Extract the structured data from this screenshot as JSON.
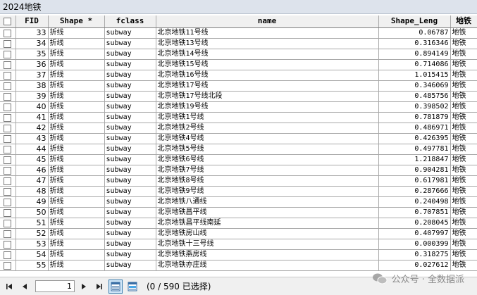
{
  "window": {
    "title": "2024地铁"
  },
  "table": {
    "columns": {
      "fid": "FID",
      "shape": "Shape *",
      "fclass": "fclass",
      "name": "name",
      "shape_leng": "Shape_Leng",
      "type": "地铁"
    },
    "rows": [
      {
        "fid": "33",
        "shape": "折线",
        "fclass": "subway",
        "name": "北京地铁11号线",
        "len": "0.06787",
        "type": "地铁"
      },
      {
        "fid": "34",
        "shape": "折线",
        "fclass": "subway",
        "name": "北京地铁13号线",
        "len": "0.316346",
        "type": "地铁"
      },
      {
        "fid": "35",
        "shape": "折线",
        "fclass": "subway",
        "name": "北京地铁14号线",
        "len": "0.894149",
        "type": "地铁"
      },
      {
        "fid": "36",
        "shape": "折线",
        "fclass": "subway",
        "name": "北京地铁15号线",
        "len": "0.714086",
        "type": "地铁"
      },
      {
        "fid": "37",
        "shape": "折线",
        "fclass": "subway",
        "name": "北京地铁16号线",
        "len": "1.015415",
        "type": "地铁"
      },
      {
        "fid": "38",
        "shape": "折线",
        "fclass": "subway",
        "name": "北京地铁17号线",
        "len": "0.346069",
        "type": "地铁"
      },
      {
        "fid": "39",
        "shape": "折线",
        "fclass": "subway",
        "name": "北京地铁17号线北段",
        "len": "0.485756",
        "type": "地铁"
      },
      {
        "fid": "40",
        "shape": "折线",
        "fclass": "subway",
        "name": "北京地铁19号线",
        "len": "0.398502",
        "type": "地铁"
      },
      {
        "fid": "41",
        "shape": "折线",
        "fclass": "subway",
        "name": "北京地铁1号线",
        "len": "0.781879",
        "type": "地铁"
      },
      {
        "fid": "42",
        "shape": "折线",
        "fclass": "subway",
        "name": "北京地铁2号线",
        "len": "0.486971",
        "type": "地铁"
      },
      {
        "fid": "43",
        "shape": "折线",
        "fclass": "subway",
        "name": "北京地铁4号线",
        "len": "0.426395",
        "type": "地铁"
      },
      {
        "fid": "44",
        "shape": "折线",
        "fclass": "subway",
        "name": "北京地铁5号线",
        "len": "0.497781",
        "type": "地铁"
      },
      {
        "fid": "45",
        "shape": "折线",
        "fclass": "subway",
        "name": "北京地铁6号线",
        "len": "1.218847",
        "type": "地铁"
      },
      {
        "fid": "46",
        "shape": "折线",
        "fclass": "subway",
        "name": "北京地铁7号线",
        "len": "0.904281",
        "type": "地铁"
      },
      {
        "fid": "47",
        "shape": "折线",
        "fclass": "subway",
        "name": "北京地铁8号线",
        "len": "0.617981",
        "type": "地铁"
      },
      {
        "fid": "48",
        "shape": "折线",
        "fclass": "subway",
        "name": "北京地铁9号线",
        "len": "0.287666",
        "type": "地铁"
      },
      {
        "fid": "49",
        "shape": "折线",
        "fclass": "subway",
        "name": "北京地铁八通线",
        "len": "0.240498",
        "type": "地铁"
      },
      {
        "fid": "50",
        "shape": "折线",
        "fclass": "subway",
        "name": "北京地铁昌平线",
        "len": "0.707851",
        "type": "地铁"
      },
      {
        "fid": "51",
        "shape": "折线",
        "fclass": "subway",
        "name": "北京地铁昌平线南延",
        "len": "0.208045",
        "type": "地铁"
      },
      {
        "fid": "52",
        "shape": "折线",
        "fclass": "subway",
        "name": "北京地铁房山线",
        "len": "0.407997",
        "type": "地铁"
      },
      {
        "fid": "53",
        "shape": "折线",
        "fclass": "subway",
        "name": "北京地铁十三号线",
        "len": "0.000399",
        "type": "地铁"
      },
      {
        "fid": "54",
        "shape": "折线",
        "fclass": "subway",
        "name": "北京地铁燕房线",
        "len": "0.318275",
        "type": "地铁"
      },
      {
        "fid": "55",
        "shape": "折线",
        "fclass": "subway",
        "name": "北京地铁亦庄线",
        "len": "0.027612",
        "type": "地铁"
      }
    ]
  },
  "status": {
    "page_value": "1",
    "selection_text": "(0 / 590 已选择)"
  },
  "watermark": {
    "text": "公众号 · 全数据派"
  },
  "icons": {
    "first": "first-record-icon",
    "prev": "previous-record-icon",
    "next": "next-record-icon",
    "last": "last-record-icon",
    "all_records": "show-all-records-icon",
    "selected_records": "show-selected-records-icon"
  }
}
